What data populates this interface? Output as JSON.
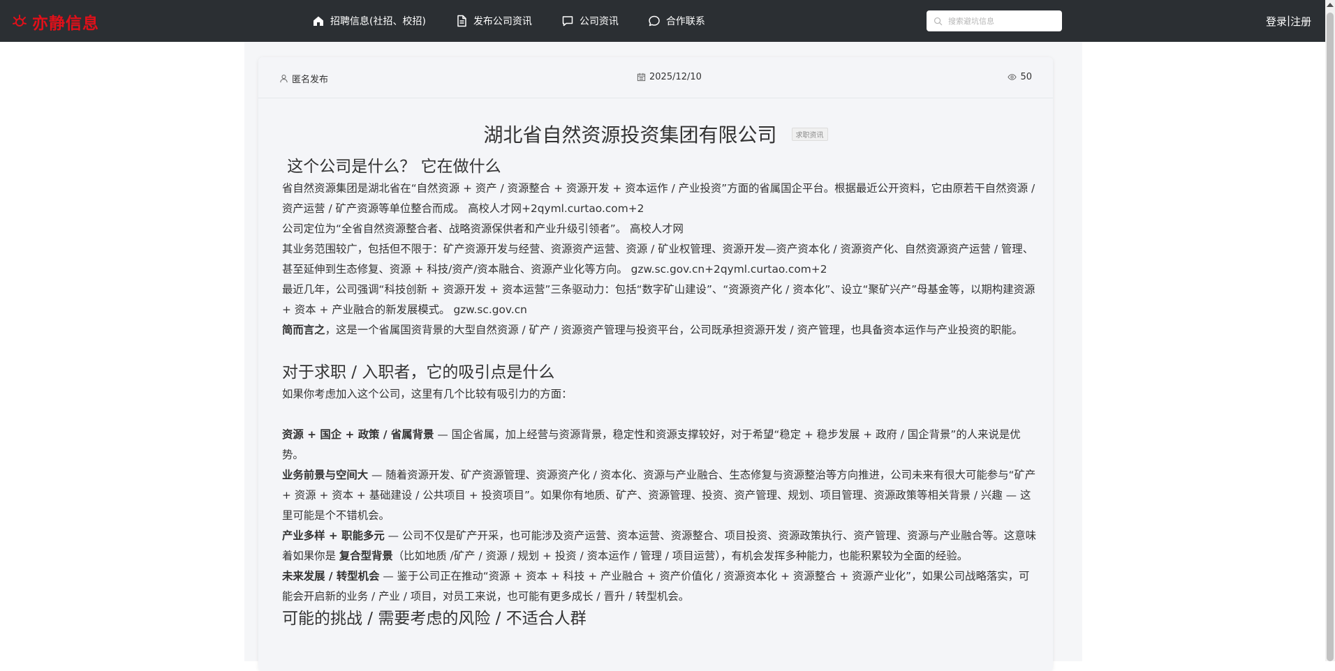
{
  "header": {
    "logo_text": "亦静信息",
    "nav": [
      {
        "label": "招聘信息(社招、校招)",
        "icon": "home-icon"
      },
      {
        "label": "发布公司资讯",
        "icon": "document-icon"
      },
      {
        "label": "公司资讯",
        "icon": "chat-square-icon"
      },
      {
        "label": "合作联系",
        "icon": "chat-bubble-icon"
      }
    ],
    "search_placeholder": "搜索避坑信息",
    "login_label": "登录",
    "separator": "|",
    "register_label": "注册"
  },
  "article": {
    "author": "匿名发布",
    "date": "2025/12/10",
    "views": "50",
    "title": "湖北省自然资源投资集团有限公司",
    "tag": "求职资讯",
    "h1": " 这个公司是什么？ 它在做什么",
    "p1": "省自然资源集团是湖北省在“自然资源 + 资产 / 资源整合 + 资源开发 + 资本运作 / 产业投资”方面的省属国企平台。根据最近公开资料，它由原若干自然资源 / 资产运营 / 矿产资源等单位整合而成。 高校人才网+2qyml.curtao.com+2",
    "p2": "公司定位为“全省自然资源整合者、战略资源保供者和产业升级引领者”。 高校人才网",
    "p3": "其业务范围较广，包括但不限于：矿产资源开发与经营、资源资产运营、资源 / 矿业权管理、资源开发—资产资本化 / 资源资产化、自然资源资产运营 / 管理、甚至延伸到生态修复、资源 + 科技/资产/资本融合、资源产业化等方向。 gzw.sc.gov.cn+2qyml.curtao.com+2",
    "p4": "最近几年，公司强调“科技创新 + 资源开发 + 资本运营”三条驱动力：包括“数字矿山建设”、“资源资产化 / 资本化”、设立“聚矿兴产”母基金等，以期构建资源 + 资本 + 产业融合的新发展模式。 gzw.sc.gov.cn",
    "p5_bold": "简而言之",
    "p5_rest": "，这是一个省属国资背景的大型自然资源 / 矿产 / 资源资产管理与投资平台，公司既承担资源开发 / 资产管理，也具备资本运作与产业投资的职能。",
    "h2": "对于求职 / 入职者，它的吸引点是什么",
    "p6": "如果你考虑加入这个公司，这里有几个比较有吸引力的方面：",
    "b1_bold": "资源 + 国企 + 政策 / 省属背景",
    "b1_rest": " — 国企省属，加上经营与资源背景，稳定性和资源支撑较好，对于希望“稳定 + 稳步发展 + 政府 / 国企背景”的人来说是优势。",
    "b2_bold": "业务前景与空间大",
    "b2_rest": " — 随着资源开发、矿产资源管理、资源资产化 / 资本化、资源与产业融合、生态修复与资源整治等方向推进，公司未来有很大可能参与“矿产 + 资源 + 资本 + 基础建设 / 公共项目 + 投资项目”。如果你有地质、矿产、资源管理、投资、资产管理、规划、项目管理、资源政策等相关背景 / 兴趣 — 这里可能是个不错机会。",
    "b3_bold": "产业多样 + 职能多元",
    "b3_mid": " — 公司不仅是矿产开采，也可能涉及资产运营、资本运营、资源整合、项目投资、资源政策执行、资产管理、资源与产业融合等。这意味着如果你是 ",
    "b3_bold2": "复合型背景",
    "b3_rest": "（比如地质 /矿产 / 资源 / 规划 + 投资 / 资本运作 / 管理 / 项目运营），有机会发挥多种能力，也能积累较为全面的经验。",
    "b4_bold": "未来发展 / 转型机会",
    "b4_rest": " — 鉴于公司正在推动“资源 + 资本 + 科技 + 产业融合 + 资产价值化 / 资源资本化 + 资源整合 + 资源产业化”，如果公司战略落实，可能会开启新的业务 / 产业 / 项目，对员工来说，也可能有更多成长 / 晋升 / 转型机会。",
    "h3": "可能的挑战 / 需要考虑的风险 / 不适合人群"
  }
}
